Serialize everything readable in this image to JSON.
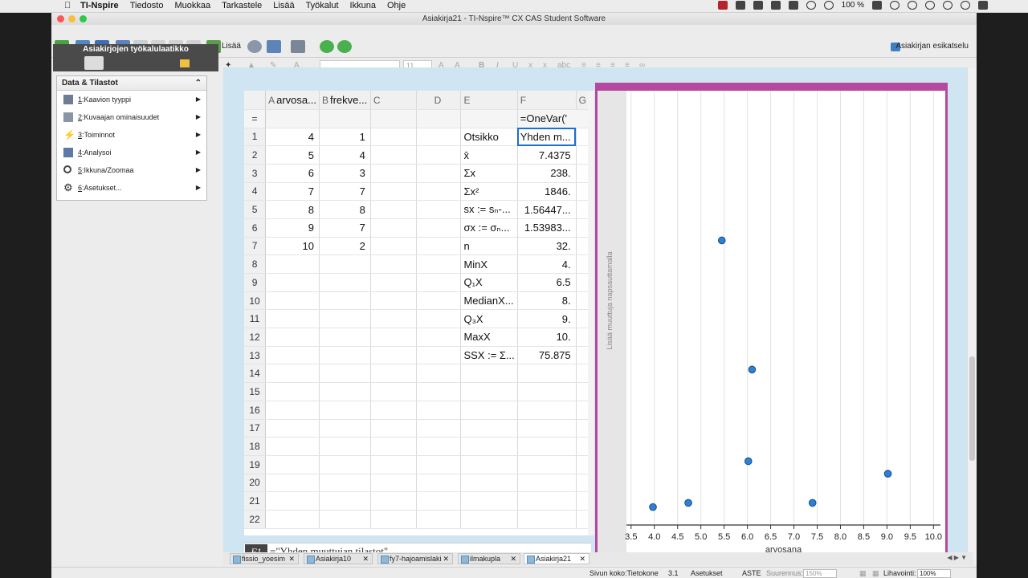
{
  "menubar": {
    "app": "TI-Nspire",
    "items": [
      "Tiedosto",
      "Muokkaa",
      "Tarkastele",
      "Lisää",
      "Työkalut",
      "Ikkuna",
      "Ohje"
    ],
    "battery": "100 %"
  },
  "window": {
    "title": "Asiakirja21 - TI-Nspire™ CX CAS Student Software"
  },
  "toolbar": {
    "insert_label": "Lisää",
    "preview_label": "Asiakirjan esikatselu",
    "font_size": "11"
  },
  "toolbox": {
    "title": "Asiakirjojen työkalulaatikko",
    "panel_title": "Data & Tilastot",
    "items": [
      {
        "num": "1",
        "label": ":Kaavion tyyppi",
        "icon": "chart-type-icon"
      },
      {
        "num": "2",
        "label": ":Kuvaajan ominaisuudet",
        "icon": "plot-properties-icon"
      },
      {
        "num": "3",
        "label": ":Toiminnot",
        "icon": "actions-icon"
      },
      {
        "num": "4",
        "label": ":Analysoi",
        "icon": "analyze-icon"
      },
      {
        "num": "5",
        "label": ":Ikkuna/Zoomaa",
        "icon": "zoom-icon"
      },
      {
        "num": "6",
        "label": ":Asetukset...",
        "icon": "settings-icon"
      }
    ]
  },
  "sheet": {
    "columns": [
      {
        "letter": "A",
        "name": "arvosa..."
      },
      {
        "letter": "B",
        "name": "frekve..."
      },
      {
        "letter": "C",
        "name": ""
      },
      {
        "letter": "D",
        "name": ""
      },
      {
        "letter": "E",
        "name": ""
      },
      {
        "letter": "F",
        "name": ""
      },
      {
        "letter": "G",
        "name": ""
      }
    ],
    "formula_row_label": "=",
    "formula_f": "=OneVar('",
    "rows": [
      {
        "n": "1",
        "a": "4",
        "b": "1",
        "e": "Otsikko",
        "f": "Yhden m..."
      },
      {
        "n": "2",
        "a": "5",
        "b": "4",
        "e": "x̄",
        "f": "7.4375"
      },
      {
        "n": "3",
        "a": "6",
        "b": "3",
        "e": "Σx",
        "f": "238."
      },
      {
        "n": "4",
        "a": "7",
        "b": "7",
        "e": "Σx²",
        "f": "1846."
      },
      {
        "n": "5",
        "a": "8",
        "b": "8",
        "e": "sx := sₙ-...",
        "f": "1.56447..."
      },
      {
        "n": "6",
        "a": "9",
        "b": "7",
        "e": "σx := σₙ...",
        "f": "1.53983..."
      },
      {
        "n": "7",
        "a": "10",
        "b": "2",
        "e": "n",
        "f": "32."
      },
      {
        "n": "8",
        "a": "",
        "b": "",
        "e": "MinX",
        "f": "4."
      },
      {
        "n": "9",
        "a": "",
        "b": "",
        "e": "Q₁X",
        "f": "6.5"
      },
      {
        "n": "10",
        "a": "",
        "b": "",
        "e": "MedianX...",
        "f": "8."
      },
      {
        "n": "11",
        "a": "",
        "b": "",
        "e": "Q₃X",
        "f": "9."
      },
      {
        "n": "12",
        "a": "",
        "b": "",
        "e": "MaxX",
        "f": "10."
      },
      {
        "n": "13",
        "a": "",
        "b": "",
        "e": "SSX := Σ...",
        "f": "75.875"
      },
      {
        "n": "14",
        "a": "",
        "b": "",
        "e": "",
        "f": ""
      },
      {
        "n": "15",
        "a": "",
        "b": "",
        "e": "",
        "f": ""
      },
      {
        "n": "16",
        "a": "",
        "b": "",
        "e": "",
        "f": ""
      },
      {
        "n": "17",
        "a": "",
        "b": "",
        "e": "",
        "f": ""
      },
      {
        "n": "18",
        "a": "",
        "b": "",
        "e": "",
        "f": ""
      },
      {
        "n": "19",
        "a": "",
        "b": "",
        "e": "",
        "f": ""
      },
      {
        "n": "20",
        "a": "",
        "b": "",
        "e": "",
        "f": ""
      },
      {
        "n": "21",
        "a": "",
        "b": "",
        "e": "",
        "f": ""
      },
      {
        "n": "22",
        "a": "",
        "b": "",
        "e": "",
        "f": ""
      }
    ],
    "entry_label": "F1",
    "entry_value": "=\"Yhden muuttujan tilastot\""
  },
  "chart_data": {
    "type": "scatter",
    "xlabel": "arvosana",
    "ylabel_hint": "Lisää muuttuja napsauttamalla",
    "xlim": [
      3.4,
      10.15
    ],
    "x_ticks": [
      "3.5",
      "4.0",
      "4.5",
      "5.0",
      "5.5",
      "6.0",
      "6.5",
      "7.0",
      "7.5",
      "8.0",
      "8.5",
      "9.0",
      "9.5",
      "10.0",
      "10."
    ],
    "points_x": [
      3.97,
      4.73,
      5.45,
      6.1,
      6.02,
      7.4,
      9.02
    ],
    "points_level": [
      0.02,
      0.03,
      0.66,
      0.35,
      0.13,
      0.03,
      0.1
    ],
    "point_color": "#2f7fd6"
  },
  "doctabs": [
    "fissio_yoesim",
    "Asiakirja10",
    "fy7-hajoamislaki",
    "ilmakupla",
    "Asiakirja21"
  ],
  "status": {
    "page_size": "Sivun koko:Tietokone",
    "page_num": "3.1",
    "settings": "Asetukset",
    "angle": "ASTE",
    "zoom_label": "Suurennus:",
    "zoom_value": "150%",
    "approx_label": "Lihavointi:",
    "approx_value": "100%"
  }
}
